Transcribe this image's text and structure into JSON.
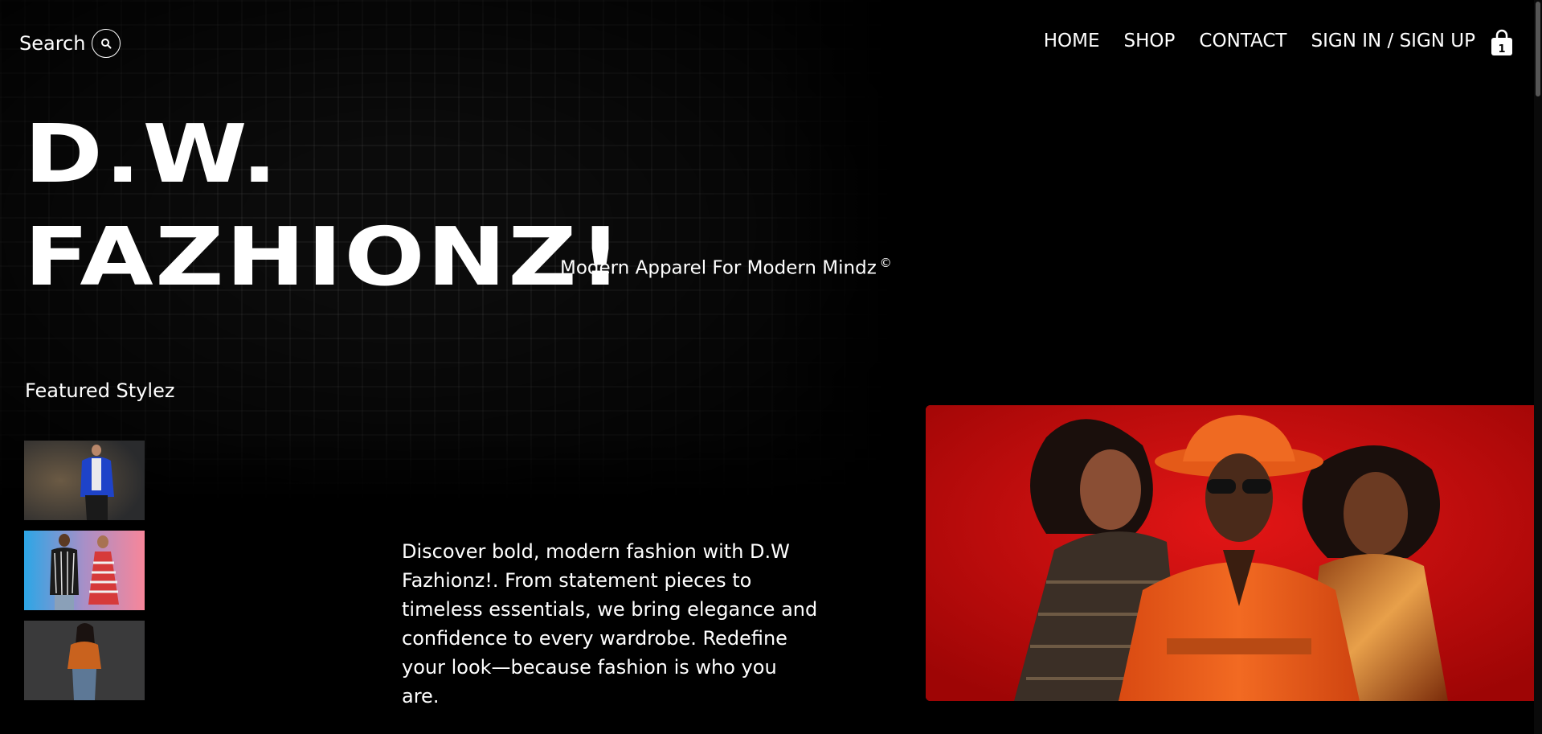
{
  "header": {
    "search_label": "Search",
    "nav": {
      "home": "HOME",
      "shop": "SHOP",
      "contact": "CONTACT",
      "auth": "SIGN IN / SIGN UP"
    },
    "cart_count": "1"
  },
  "hero": {
    "brand_line1": "D.W.",
    "brand_line2": "FAZHIONZ!",
    "tagline": "Modern Apparel For Modern Mindz",
    "tagline_mark": "©",
    "featured_title": "Featured Stylez",
    "description": "Discover bold, modern fashion with D.W Fazhionz!. From statement pieces to timeless essentials, we bring elegance and confidence to every wardrobe. Redefine your look—because fashion is who you are."
  },
  "colors": {
    "background": "#000000",
    "text": "#ffffff",
    "hero_red": "#d10a0a",
    "suit_orange": "#e8561a"
  }
}
